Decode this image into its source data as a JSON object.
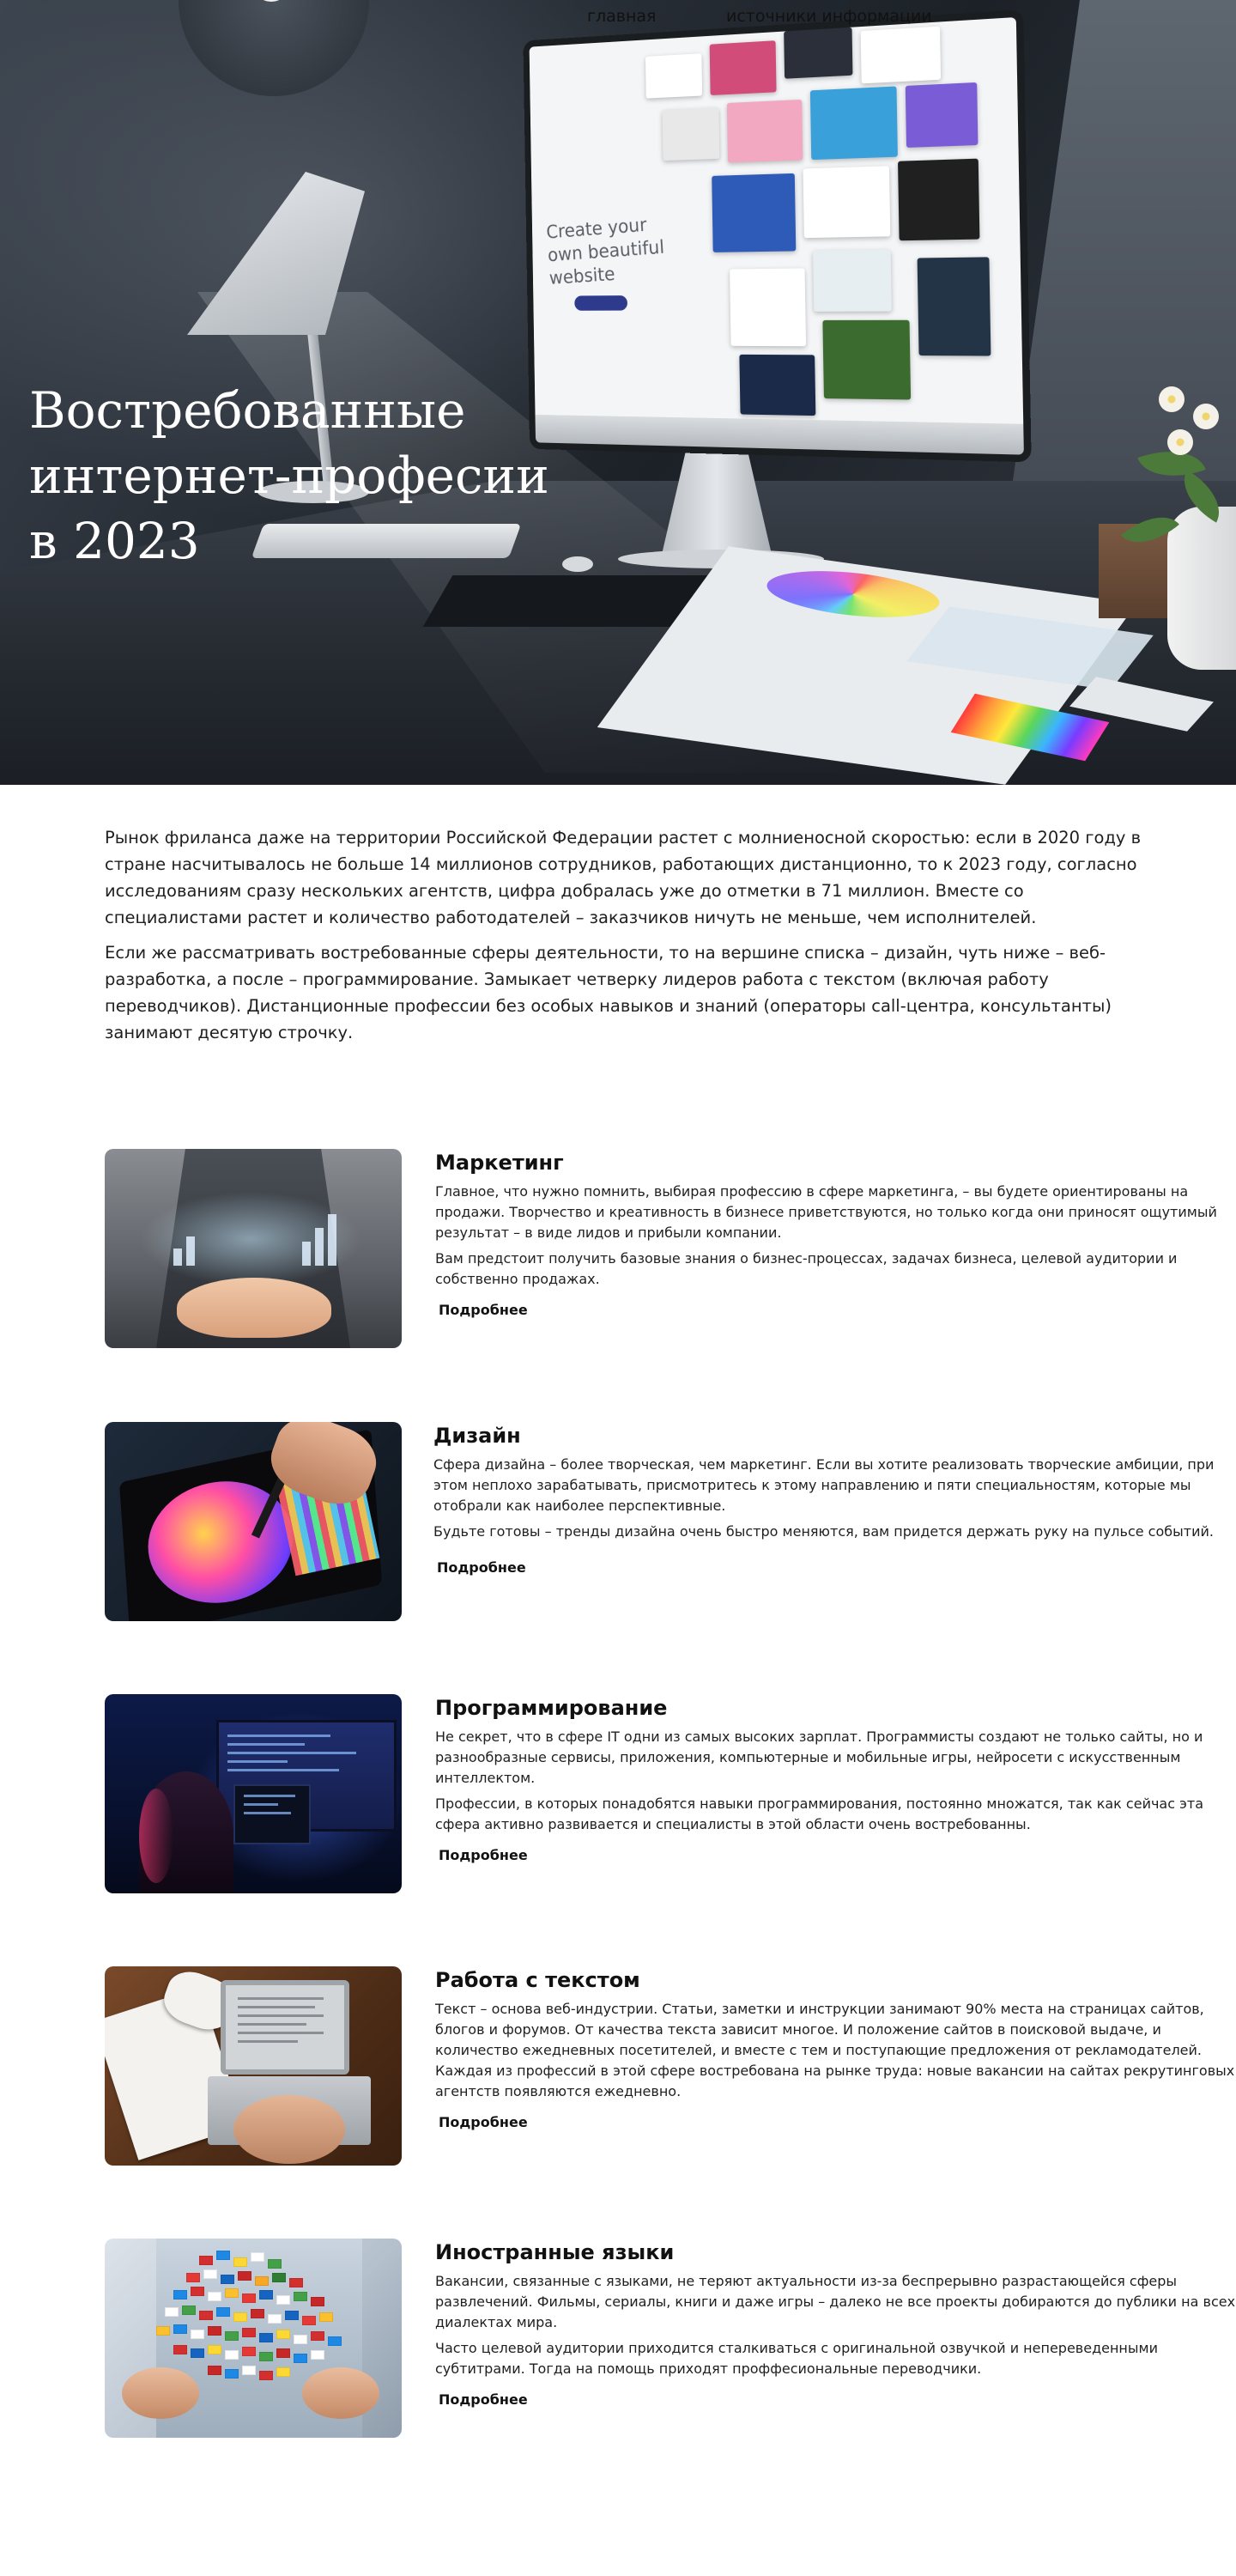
{
  "nav": {
    "home": "главная",
    "sources": "источники информации"
  },
  "hero": {
    "title_line1": "Востребованные",
    "title_line2": "интернет-професии",
    "title_line3": "в 2023",
    "screen_text": "Create your own beautiful website"
  },
  "intro": {
    "p1": "Рынок фриланса даже на территории Российской Федерации растет с молниеносной скоростью: если в 2020 году в стране насчитывалось не больше 14 миллионов сотрудников, работающих дистанционно, то к 2023 году, согласно исследованиям сразу нескольких агентств, цифра добралась уже до отметки в 71 миллион. Вместе со специалистами растет и количество работодателей – заказчиков ничуть не меньше, чем исполнителей.",
    "p2": "Если же рассматривать востребованные сферы деятельности, то на вершине списка – дизайн, чуть ниже – веб-разработка, а после – программирование. Замыкает четверку лидеров работа с текстом (включая работу переводчиков). Дистанционные профессии без особых навыков и знаний (операторы call-центра, консультанты) занимают десятую строчку."
  },
  "more_label": "Подробнее",
  "cards": [
    {
      "title": "Маркетинг",
      "p1": "Главное, что нужно помнить, выбирая профессию в сфере маркетинга, – вы будете ориентированы на продажи. Творчество и креативность в бизнесе приветствуются, но только когда они приносят ощутимый результат – в виде лидов и прибыли компании.",
      "p2": "Вам предстоит получить базовые знания о бизнес-процессах, задачах бизнеса, целевой аудитории и собственно продажах."
    },
    {
      "title": "Дизайн",
      "p1": "Сфера дизайна – более творческая, чем маркетинг. Если вы хотите реализовать творческие амбиции, при этом неплохо зарабатывать, присмотритесь к этому направлению и пяти специальностям, которые мы отобрали как наиболее перспективные.",
      "p2": "Будьте готовы – тренды дизайна очень быстро меняются, вам придется держать руку на пульсе событий."
    },
    {
      "title": "Программирование",
      "p1": "Не секрет, что в сфере IT одни из самых высоких зарплат. Программисты создают не только сайты, но и разнообразные сервисы, приложения, компьютерные и мобильные игры, нейросети с искусственным интеллектом.",
      "p2": "Профессии, в которых понадобятся навыки программирования, постоянно множатся, так как сейчас эта сфера активно развивается и специалисты в этой области очень востребованны."
    },
    {
      "title": "Работа с текстом",
      "p1": "Текст – основа веб-индустрии. Статьи, заметки и инструкции занимают 90% места на страницах сайтов, блогов и форумов. От качества текста зависит многое. И положение сайтов в поисковой выдаче, и количество ежедневных посетителей, и вместе с тем и поступающие предложения от рекламодателей. Каждая из профессий в этой сфере востребована на рынке труда: новые вакансии на сайтах рекрутинговых агентств появляются ежедневно.",
      "p2": ""
    },
    {
      "title": "Иностранные языки",
      "p1": "Вакансии, связанные с языками, не теряют актуальности из-за беспрерывно разрастающейся сферы развлечений. Фильмы, сериалы, книги и даже игры – далеко не все проекты добираются до публики на всех диалектах мира.",
      "p2": "Часто целевой аудитории приходится сталкиваться с оригинальной озвучкой и непереведенными субтитрами. Тогда на помощь приходят проффесиональные переводчики."
    }
  ]
}
